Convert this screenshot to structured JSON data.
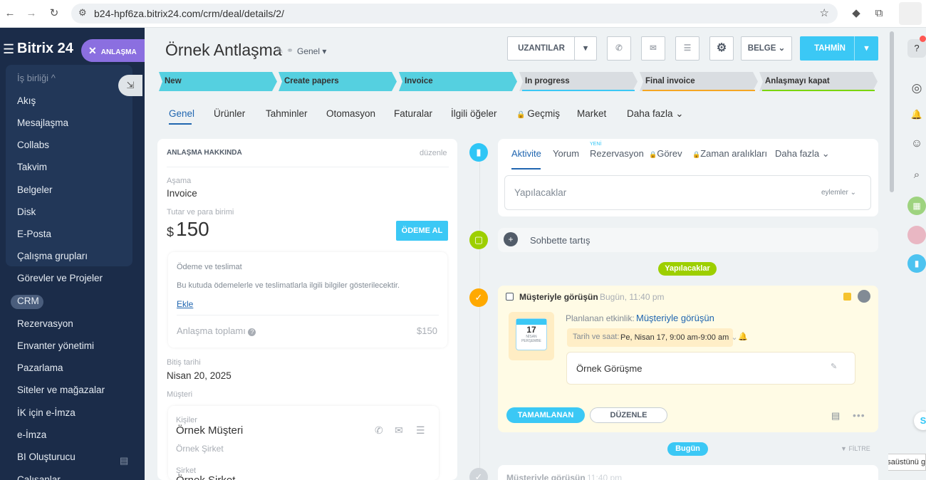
{
  "browser": {
    "url": "b24-hpf6za.bitrix24.com/crm/deal/details/2/"
  },
  "sidebar": {
    "logo": "Bitrix 24",
    "close_badge": "ANLAŞMA",
    "section_label": "İş birliği",
    "items": [
      "Akış",
      "Mesajlaşma",
      "Collabs",
      "Takvim",
      "Belgeler",
      "Disk",
      "E-Posta",
      "Çalışma grupları",
      "Görevler ve Projeler",
      "CRM",
      "Rezervasyon",
      "Envanter yönetimi",
      "Pazarlama",
      "Siteler ve mağazalar",
      "İK için e-İmza",
      "e-İmza",
      "BI Oluşturucu",
      "Çalışanlar"
    ]
  },
  "header": {
    "title": "Örnek Antlaşma",
    "category": "Genel",
    "btn_extensions": "UZANTILAR",
    "btn_document": "BELGE",
    "btn_forecast": "TAHMİN"
  },
  "stages": [
    {
      "label": "New",
      "color": "#55d0e0",
      "active": true
    },
    {
      "label": "Create papers",
      "color": "#55d0e0",
      "active": true
    },
    {
      "label": "Invoice",
      "color": "#55d0e0",
      "active": true
    },
    {
      "label": "In progress",
      "color": "#d9dde1",
      "underline": "#3bc8f5",
      "active": false
    },
    {
      "label": "Final invoice",
      "color": "#d9dde1",
      "underline": "#f5a623",
      "active": false
    },
    {
      "label": "Anlaşmayı kapat",
      "color": "#d9dde1",
      "underline": "#7bd500",
      "active": false
    }
  ],
  "tabs": [
    "Genel",
    "Ürünler",
    "Tahminler",
    "Otomasyon",
    "Faturalar",
    "İlgili öğeler",
    "Geçmiş",
    "Market",
    "Daha fazla"
  ],
  "deal_info": {
    "section_title": "ANLAŞMA HAKKINDA",
    "edit_link": "düzenle",
    "stage_label": "Aşama",
    "stage_value": "Invoice",
    "amount_label": "Tutar ve para birimi",
    "currency_symbol": "$",
    "amount": "150",
    "pay_button": "ÖDEME AL",
    "payment_title": "Ödeme ve teslimat",
    "payment_desc": "Bu kutuda ödemelerle ve teslimatlarla ilgili bilgiler gösterilecektir.",
    "add_link": "Ekle",
    "total_label": "Anlaşma toplamı",
    "total_value": "$150",
    "end_date_label": "Bitiş tarihi",
    "end_date": "Nisan 20, 2025",
    "client_label": "Müşteri",
    "contact_label": "Kişiler",
    "contact_name": "Örnek Müşteri",
    "contact_company": "Örnek Şirket",
    "company_label": "Şirket",
    "company_name": "Örnek Şirket"
  },
  "activity": {
    "tabs": [
      "Aktivite",
      "Yorum",
      "Rezervasyon",
      "Görev",
      "Zaman aralıkları",
      "Daha fazla"
    ],
    "new_badge": "YENİ",
    "todo_placeholder": "Yapılacaklar",
    "actions_label": "eylemler",
    "chat_label": "Sohbette tartış",
    "todo_pill": "Yapılacaklar",
    "item": {
      "title": "Müşteriyle görüşün",
      "time": "Bugün, 11:40 pm",
      "planned_label": "Planlanan etkinlik:",
      "planned_link": "Müşteriyle görüşün",
      "calendar_day": "17",
      "calendar_month": "NİSAN",
      "calendar_weekday": "PERŞEMBE",
      "datetime_label": "Tarih ve saat:",
      "datetime_value": "Pe, Nisan 17, 9:00 am-9:00 am",
      "note": "Örnek Görüşme",
      "btn_complete": "TAMAMLANAN",
      "btn_edit": "DÜZENLE"
    },
    "today_pill": "Bugün",
    "filter_label": "FİLTRE",
    "next_title": "Müşteriyle görüşün",
    "next_time": "11:40 pm"
  },
  "tooltip": "Masaüstünü gö",
  "colors": {
    "sidebar_bg": "#1b2c49",
    "accent": "#3bc8f5",
    "stage_active": "#55d0e0",
    "badge_purple": "#8b6fe0",
    "green": "#9dcf00",
    "orange": "#ffa900",
    "todo_bg": "#fffbe5"
  }
}
